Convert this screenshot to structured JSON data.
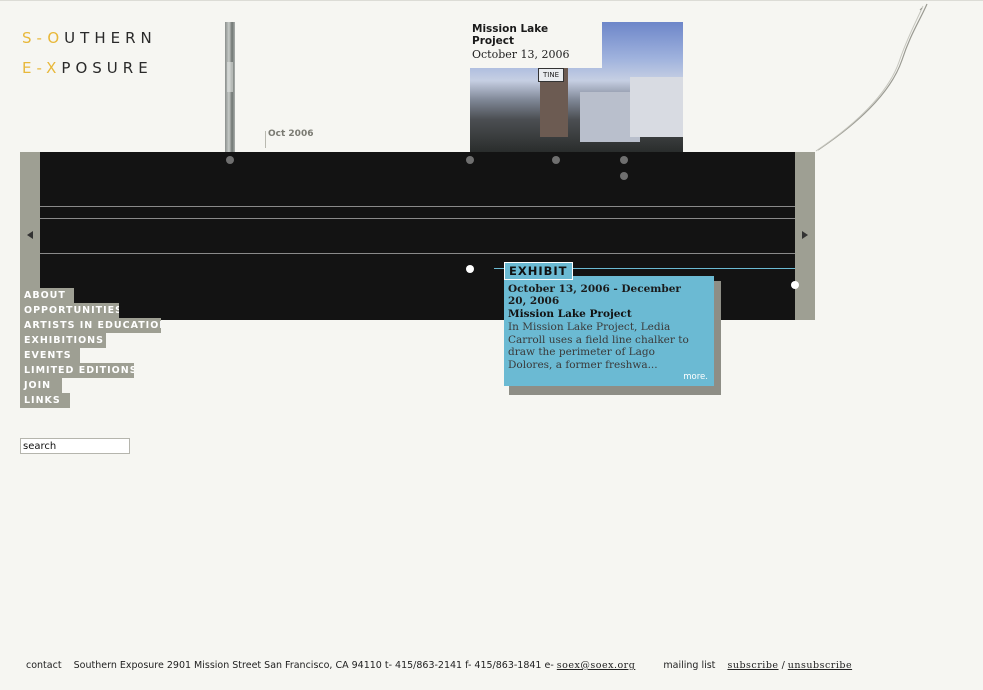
{
  "logo": {
    "line1_mark": "S-O",
    "line1_rest": "UTHERN",
    "line2_mark": "E-X",
    "line2_rest": "POSURE",
    "accent_color": "#e8b83a"
  },
  "timeline": {
    "month_label": "Oct 2006",
    "feature": {
      "title": "Mission Lake Project",
      "date": "October 13, 2006",
      "photo_sign": "TINE"
    },
    "prev_icon": "arrow-left",
    "next_icon": "arrow-right",
    "background": "#131313",
    "highlight_color": "#6bbad3"
  },
  "popup": {
    "tag": "EXHIBIT",
    "date_range": "October 13, 2006 - December 20, 2006",
    "title": "Mission Lake Project",
    "description": "In Mission Lake Project, Ledia Carroll uses a field line chalker to draw the perimeter of Lago Dolores, a former freshwa...",
    "more": "more."
  },
  "nav": {
    "items": [
      {
        "label": "ABOUT"
      },
      {
        "label": "OPPORTUNITIES"
      },
      {
        "label": "ARTISTS IN EDUCATION"
      },
      {
        "label": "EXHIBITIONS"
      },
      {
        "label": "EVENTS"
      },
      {
        "label": "LIMITED EDITIONS"
      },
      {
        "label": "JOIN"
      },
      {
        "label": "LINKS"
      }
    ]
  },
  "search": {
    "value": "search"
  },
  "footer": {
    "contact_label": "contact",
    "address": "Southern Exposure 2901 Mission Street San Francisco, CA 94110 t- 415/863-2141 f- 415/863-1841 e-",
    "email": "soex@soex.org",
    "mailing_label": "mailing list",
    "subscribe": "subscribe",
    "separator": "/",
    "unsubscribe": "unsubscribe"
  }
}
